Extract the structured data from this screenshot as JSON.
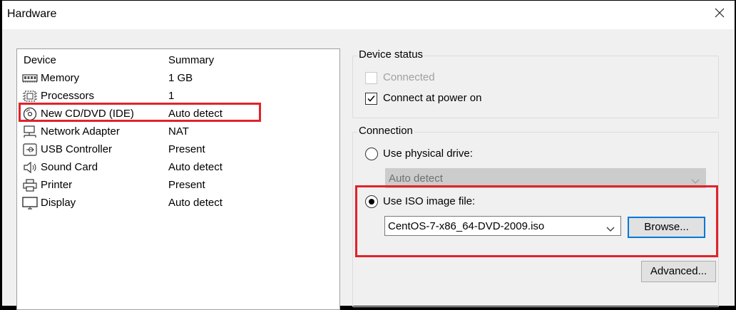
{
  "window": {
    "title": "Hardware",
    "close_icon": "close-icon"
  },
  "device_list": {
    "headers": {
      "device": "Device",
      "summary": "Summary"
    },
    "items": [
      {
        "name": "Memory",
        "summary": "1 GB",
        "icon": "memory-icon"
      },
      {
        "name": "Processors",
        "summary": "1",
        "icon": "processor-icon"
      },
      {
        "name": "New CD/DVD (IDE)",
        "summary": "Auto detect",
        "icon": "cd-dvd-icon"
      },
      {
        "name": "Network Adapter",
        "summary": "NAT",
        "icon": "network-adapter-icon"
      },
      {
        "name": "USB Controller",
        "summary": "Present",
        "icon": "usb-icon"
      },
      {
        "name": "Sound Card",
        "summary": "Auto detect",
        "icon": "speaker-icon"
      },
      {
        "name": "Printer",
        "summary": "Present",
        "icon": "printer-icon"
      },
      {
        "name": "Display",
        "summary": "Auto detect",
        "icon": "monitor-icon"
      }
    ],
    "selected_index": 2
  },
  "device_status": {
    "title": "Device status",
    "connected": {
      "label": "Connected",
      "checked": false,
      "enabled": false
    },
    "connect_at_power_on": {
      "label": "Connect at power on",
      "checked": true
    }
  },
  "connection": {
    "title": "Connection",
    "physical_drive": {
      "label": "Use physical drive:",
      "selected": false,
      "value": "Auto detect"
    },
    "iso_image": {
      "label": "Use ISO image file:",
      "selected": true,
      "value": "CentOS-7-x86_64-DVD-2009.iso"
    },
    "browse_label": "Browse...",
    "advanced_label": "Advanced..."
  },
  "colors": {
    "highlight": "#e0232a",
    "focus": "#0078d7"
  }
}
